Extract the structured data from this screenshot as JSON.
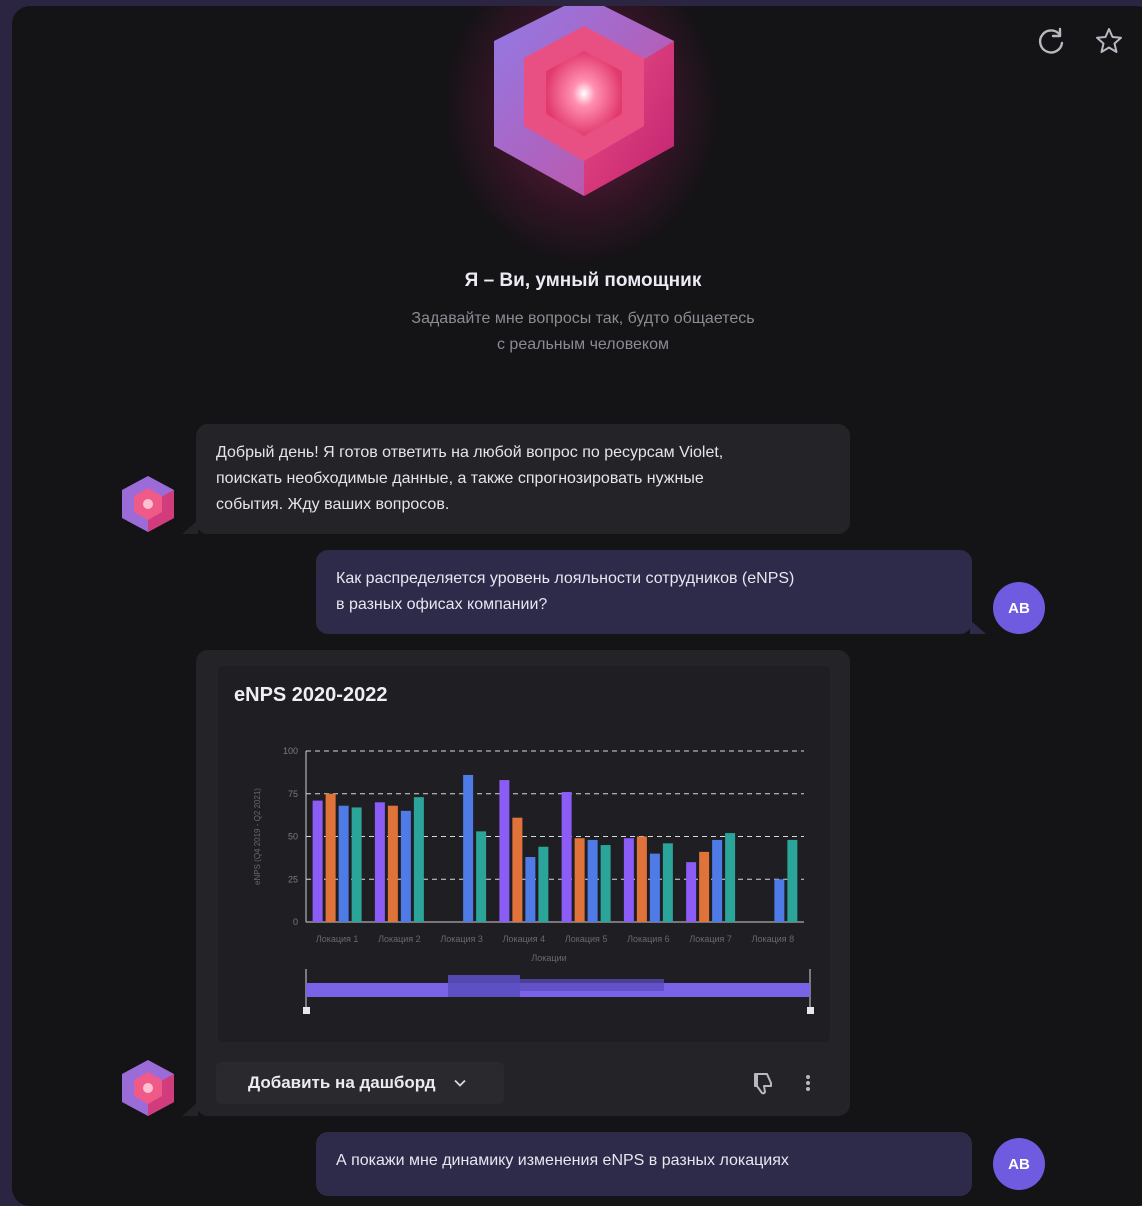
{
  "header": {
    "refresh_icon": "refresh-icon",
    "star_icon": "star-icon"
  },
  "hero": {
    "title": "Я – Ви, умный помощник",
    "subtitle_line1": "Задавайте мне вопросы так, будто общаетесь",
    "subtitle_line2": "с реальным человеком"
  },
  "messages": {
    "bot_greeting": [
      "Добрый день! Я готов ответить на любой вопрос по ресурсам Violet,",
      "поискать необходимые данные, а также спрогнозировать нужные",
      "события. Жду ваших вопросов."
    ],
    "user_q1": [
      "Как распределяется уровень лояльности сотрудников (eNPS)",
      "в разных офисах компании?"
    ],
    "user_q2": "А покажи мне динамику изменения eNPS в разных локациях",
    "user_initials": "AB"
  },
  "actions": {
    "add_dashboard": "Добавить на дашборд",
    "dislike_icon": "thumbs-down-icon",
    "more_icon": "more-vertical-icon"
  },
  "colors": {
    "series1": "#8b5cf6",
    "series2": "#e0733a",
    "series3": "#4f7be6",
    "series4": "#2ba59a",
    "accent": "#6f5be0"
  },
  "chart_data": {
    "type": "bar",
    "title": "eNPS 2020-2022",
    "xlabel": "Локации",
    "ylabel": "eNPS (Q4 2019 - Q2 2021)",
    "ylim": [
      0,
      100
    ],
    "yticks": [
      "0",
      "25",
      "50",
      "75",
      "100"
    ],
    "grid": true,
    "categories": [
      "Локация 1",
      "Локация 2",
      "Локация 3",
      "Локация 4",
      "Локация 5",
      "Локация 6",
      "Локация 7",
      "Локация 8"
    ],
    "series": [
      {
        "values": [
          71,
          70,
          null,
          83,
          76,
          49,
          35,
          null
        ]
      },
      {
        "values": [
          75,
          68,
          null,
          61,
          49,
          50,
          41,
          null
        ]
      },
      {
        "values": [
          68,
          65,
          86,
          38,
          48,
          40,
          48,
          25
        ]
      },
      {
        "values": [
          67,
          73,
          53,
          44,
          45,
          46,
          52,
          48
        ]
      }
    ]
  }
}
